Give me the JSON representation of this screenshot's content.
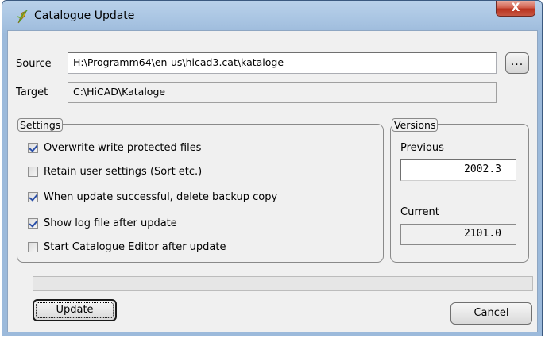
{
  "window": {
    "title": "Catalogue Update",
    "close_glyph": "X",
    "icon": "hicad-app-icon"
  },
  "source": {
    "label": "Source",
    "value": "H:\\Programm64\\en-us\\hicad3.cat\\kataloge",
    "browse_label": "..."
  },
  "target": {
    "label": "Target",
    "value": "C:\\HiCAD\\Kataloge"
  },
  "settings": {
    "title": "Settings",
    "options": [
      {
        "label": "Overwrite write protected files",
        "checked": true
      },
      {
        "label": "Retain user settings (Sort etc.)",
        "checked": false
      },
      {
        "label": "When update successful, delete backup copy",
        "checked": true
      },
      {
        "label": "Show log file after update",
        "checked": true
      },
      {
        "label": "Start Catalogue Editor after update",
        "checked": false
      }
    ]
  },
  "versions": {
    "title": "Versions",
    "previous_label": "Previous",
    "previous_value": "2002.3",
    "current_label": "Current",
    "current_value": "2101.0"
  },
  "progress": {
    "value": 0
  },
  "buttons": {
    "update": "Update",
    "cancel": "Cancel"
  },
  "colors": {
    "title_bar": "#9cbadb",
    "close_button": "#c65642",
    "dialog_background": "#f0f0f0",
    "checkmark": "#2a4fa8"
  }
}
